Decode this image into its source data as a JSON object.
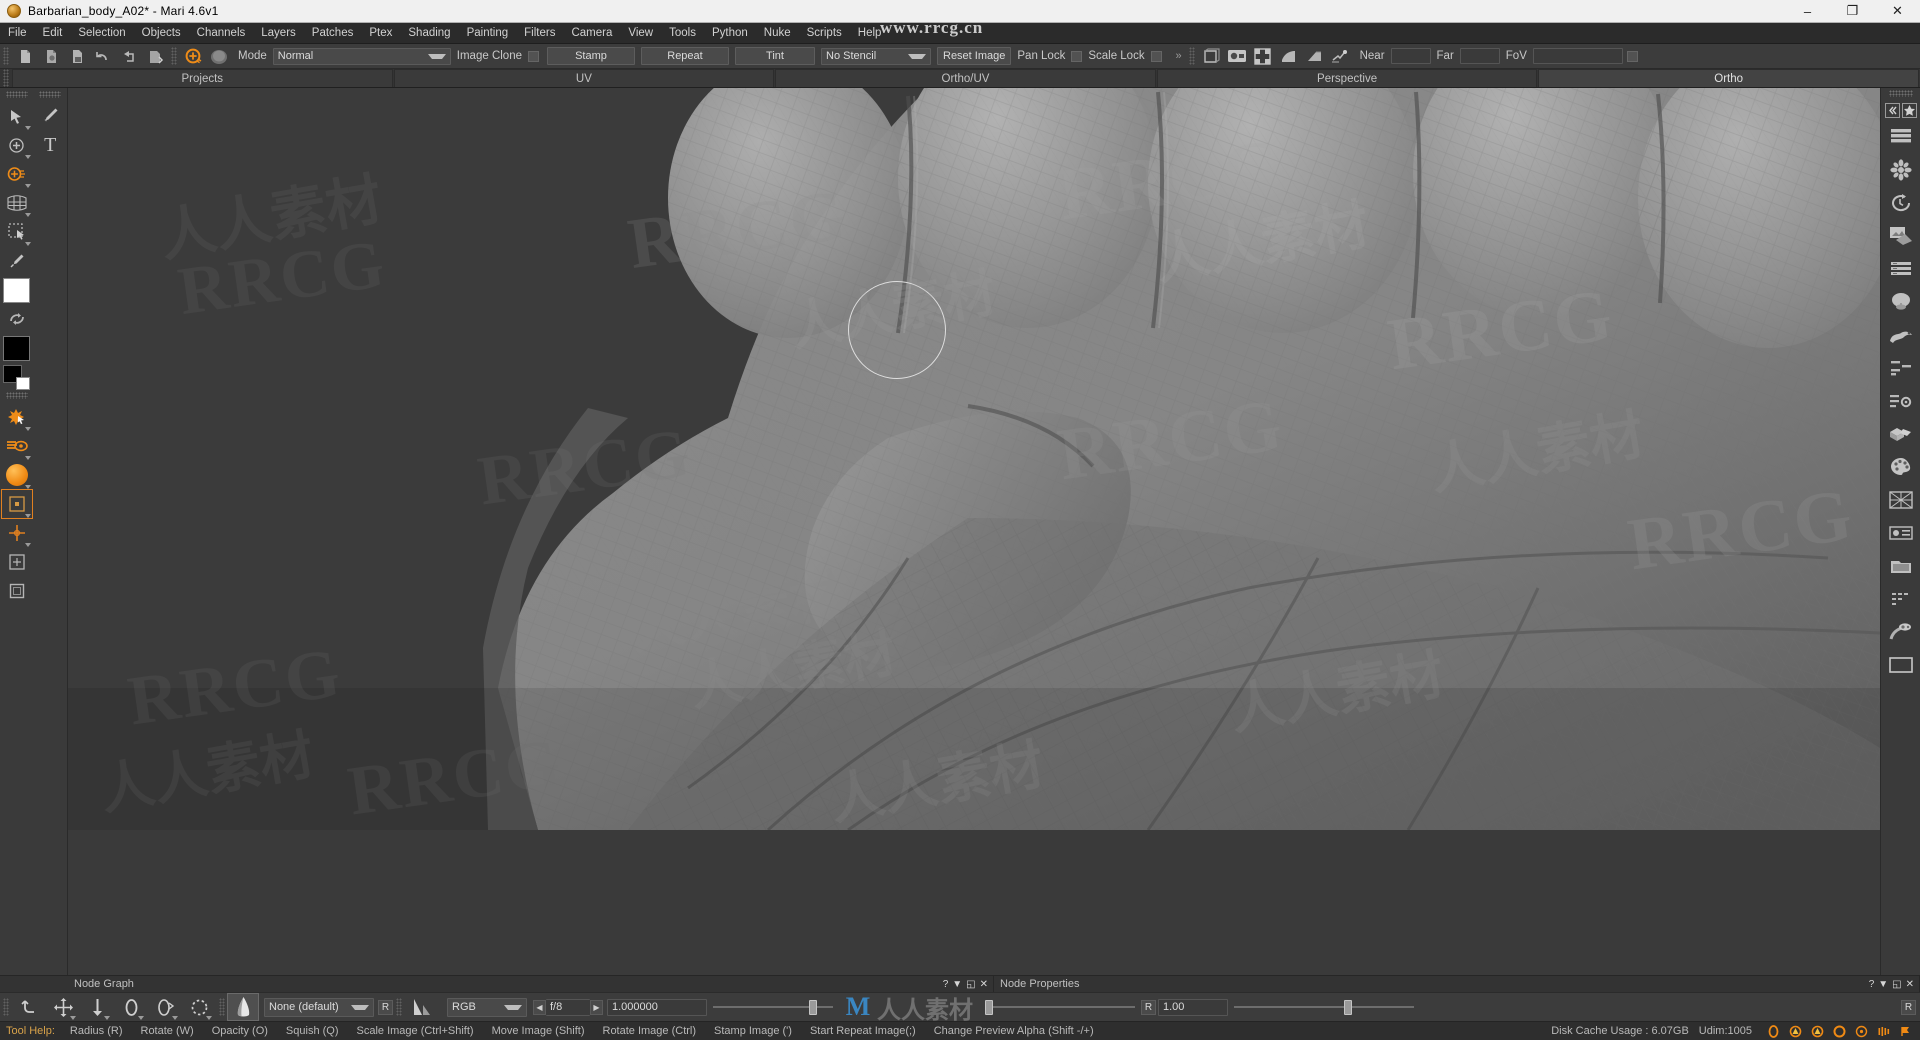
{
  "window": {
    "title": "Barbarian_body_A02* - Mari 4.6v1",
    "app_icon": "mari-sphere-icon",
    "minimize": "–",
    "maximize": "❐",
    "close": "✕"
  },
  "watermark": {
    "url": "www.rrcg.cn",
    "text_latin": "RRCG",
    "text_cn": "人人素材"
  },
  "menu": {
    "items": [
      "File",
      "Edit",
      "Selection",
      "Objects",
      "Channels",
      "Layers",
      "Patches",
      "Ptex",
      "Shading",
      "Painting",
      "Filters",
      "Camera",
      "View",
      "Tools",
      "Python",
      "Nuke",
      "Scripts",
      "Help"
    ]
  },
  "toolbar": {
    "left_icons": [
      "new-project-icon",
      "open-project-icon",
      "save-project-icon",
      "undo-icon",
      "redo-icon",
      "import-icon"
    ],
    "paint_target_icon": "paint-target-icon",
    "brush_preview_icon": "brush-preview-icon",
    "mode_label": "Mode",
    "mode_value": "Normal",
    "image_clone_label": "Image Clone",
    "image_clone_checked": false,
    "stamp_button": "Stamp",
    "repeat_button": "Repeat",
    "tint_button": "Tint",
    "stencil_value": "No Stencil",
    "reset_image_button": "Reset Image",
    "pan_lock_label": "Pan Lock",
    "pan_lock_checked": false,
    "scale_lock_label": "Scale Lock",
    "scale_lock_checked": false,
    "overflow_icon": "chevron-double-right-icon",
    "right_icons": [
      "perspective-camera-icon",
      "camera-snapshot-icon",
      "uv-grid-icon",
      "shading-sphere-icon",
      "lighting-icon",
      "turntable-icon"
    ],
    "near_label": "Near",
    "near_value": "",
    "far_label": "Far",
    "far_value": "",
    "fov_label": "FoV",
    "fov_value": ""
  },
  "tabs": [
    {
      "label": "Projects",
      "active": false
    },
    {
      "label": "UV",
      "active": false
    },
    {
      "label": "Ortho/UV",
      "active": false
    },
    {
      "label": "Perspective",
      "active": false
    },
    {
      "label": "Ortho",
      "active": true
    }
  ],
  "left_tools": {
    "column_a": [
      {
        "name": "select-arrow-tool",
        "icon": "cursor-arrow-icon",
        "has_menu": true,
        "active": false
      },
      {
        "name": "add-point-tool",
        "icon": "target-plus-icon",
        "has_menu": true,
        "active": false
      },
      {
        "name": "paint-brush-tool",
        "icon": "brush-plus-icon",
        "has_menu": true,
        "active": false
      },
      {
        "name": "warp-grid-tool",
        "icon": "grid-mesh-icon",
        "has_menu": true,
        "active": false
      },
      {
        "name": "marquee-select-tool",
        "icon": "marquee-cursor-icon",
        "has_menu": true,
        "active": false
      },
      {
        "name": "color-picker-tool",
        "icon": "eyedropper-icon",
        "has_menu": false,
        "active": false
      },
      {
        "name": "foreground-color-swatch",
        "icon": "white-swatch-icon",
        "has_menu": false,
        "active": false
      },
      {
        "name": "swap-colors",
        "icon": "swap-arrows-icon",
        "has_menu": false,
        "active": false
      },
      {
        "name": "background-color-swatch",
        "icon": "black-swatch-icon",
        "has_menu": false,
        "active": false
      },
      {
        "name": "default-colors",
        "icon": "dual-swatch-icon",
        "has_menu": false,
        "active": false
      },
      {
        "name": "paint-select-tool",
        "icon": "orange-select-icon",
        "has_menu": true,
        "active": false
      },
      {
        "name": "paint-through-tool",
        "icon": "orange-eye-icon",
        "has_menu": true,
        "active": false
      },
      {
        "name": "color-dot-tool",
        "icon": "orange-sphere-icon",
        "has_menu": true,
        "active": false
      },
      {
        "name": "transform-tool",
        "icon": "transform-box-icon",
        "has_menu": true,
        "active": true
      },
      {
        "name": "clone-stamp-tool",
        "icon": "clone-cross-icon",
        "has_menu": true,
        "active": false
      },
      {
        "name": "blur-tool",
        "icon": "blur-square-icon",
        "has_menu": false,
        "active": false
      },
      {
        "name": "crop-tool",
        "icon": "crop-frame-icon",
        "has_menu": false,
        "active": false
      }
    ],
    "column_b": [
      {
        "name": "paint-tool",
        "icon": "paintbrush-icon",
        "has_menu": false,
        "active": false
      },
      {
        "name": "text-tool",
        "icon": "text-T-icon",
        "has_menu": false,
        "active": false
      }
    ]
  },
  "right_tools": [
    {
      "name": "collapse-panel-button",
      "icon": "double-chevron-left-icon"
    },
    {
      "name": "palette-picker-button",
      "icon": "palette-star-icon"
    },
    {
      "name": "layers-palette",
      "icon": "layers-stack-icon"
    },
    {
      "name": "shelf-palette",
      "icon": "flower-shelf-icon"
    },
    {
      "name": "history-palette",
      "icon": "history-clock-icon"
    },
    {
      "name": "image-manager-palette",
      "icon": "image-manager-icon"
    },
    {
      "name": "channels-palette",
      "icon": "channels-list-icon"
    },
    {
      "name": "shading-palette",
      "icon": "shading-dome-icon"
    },
    {
      "name": "python-palette",
      "icon": "python-snake-icon"
    },
    {
      "name": "projects-palette",
      "icon": "project-list-icon"
    },
    {
      "name": "settings-palette",
      "icon": "gear-list-icon"
    },
    {
      "name": "objects-palette",
      "icon": "objects-boxes-icon"
    },
    {
      "name": "colors-palette",
      "icon": "artist-palette-icon"
    },
    {
      "name": "uv-patches-palette",
      "icon": "uv-patch-grid-icon"
    },
    {
      "name": "projection-palette",
      "icon": "projection-icon"
    },
    {
      "name": "ptex-palette",
      "icon": "ptex-folder-icon"
    },
    {
      "name": "node-list-palette",
      "icon": "node-list-icon"
    },
    {
      "name": "camera-palette",
      "icon": "camera-path-icon"
    },
    {
      "name": "viewer-palette",
      "icon": "viewer-screen-icon"
    }
  ],
  "panels": {
    "node_graph": {
      "title": "Node Graph",
      "buttons": [
        "?",
        "▼",
        "◱",
        "✕"
      ]
    },
    "node_properties": {
      "title": "Node Properties",
      "buttons": [
        "?",
        "▼",
        "◱",
        "✕"
      ]
    }
  },
  "bottombar": {
    "history_icons": [
      {
        "name": "undo-stroke-button",
        "icon": "undo-curve-icon",
        "has_menu": false
      },
      {
        "name": "move-stroke-button",
        "icon": "move-arrows-icon",
        "has_menu": true
      },
      {
        "name": "bake-down-button",
        "icon": "arrow-down-icon",
        "has_menu": true
      },
      {
        "name": "rotate-stroke-button",
        "icon": "rotate-ring-icon",
        "has_menu": true
      },
      {
        "name": "scale-stroke-button",
        "icon": "scale-ring-icon",
        "has_menu": true
      },
      {
        "name": "clear-stroke-button",
        "icon": "dashed-ring-icon",
        "has_menu": true
      }
    ],
    "brush_tip_icon": "brush-tip-icon",
    "brush_tip_active": true,
    "brush_preset_value": "None (default)",
    "brush_preset_reset": "R",
    "falloff_icon": "falloff-curve-icon",
    "channel_value": "RGB",
    "aperture_prev": "◀",
    "aperture_value": "f/8",
    "aperture_next": "▶",
    "gamma_value": "1.000000",
    "mari_logo": "mari-logo-icon",
    "opacity_reset": "R",
    "opacity_value": "1.00",
    "right_reset": "R"
  },
  "statusbar": {
    "tool_help_label": "Tool Help:",
    "hints": [
      "Radius (R)",
      "Rotate (W)",
      "Opacity (O)",
      "Squish (Q)",
      "Scale Image (Ctrl+Shift)",
      "Move Image (Shift)",
      "Rotate Image (Ctrl)",
      "Stamp Image (')",
      "Start Repeat Image(;)",
      "Change Preview Alpha (Shift -/+)"
    ],
    "disk_cache": "Disk Cache Usage : 6.07GB",
    "udim": "Udim:1005",
    "tray_icons": [
      "orange-ring-icon",
      "warning-a-icon",
      "warning-b-icon",
      "orange-circle-icon",
      "orange-dot-icon",
      "bars-icon",
      "orange-flag-icon"
    ]
  },
  "viewport": {
    "brush_cursor": "brush-circle-cursor",
    "subject": "3d-hand-sculpt-model"
  },
  "colors": {
    "accent": "#e08020",
    "titlebar_bg": "#f0f0f0",
    "chrome_bg": "#3c3c3c",
    "viewport_bg": "#3a3a3a",
    "text": "#c8c8c8",
    "status_accent": "#d8a24a"
  }
}
